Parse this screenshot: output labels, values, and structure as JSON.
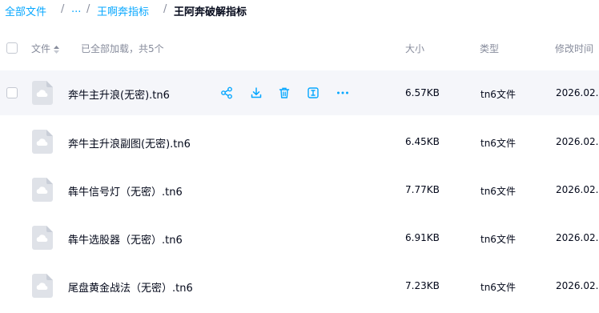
{
  "breadcrumb": {
    "items": [
      "全部文件",
      "...",
      "王啊奔指标"
    ],
    "current": "王阿奔破解指标",
    "separator": "/"
  },
  "list_header": {
    "name_label": "文件",
    "status_text": "已全部加载，共5个",
    "size_label": "大小",
    "type_label": "类型",
    "date_label": "修改时间"
  },
  "files": [
    {
      "name": "奔牛主升浪(无密).tn6",
      "size": "6.57KB",
      "type": "tn6文件",
      "date": "2026.02..."
    },
    {
      "name": "奔牛主升浪副图(无密).tn6",
      "size": "6.45KB",
      "type": "tn6文件",
      "date": "2026.02..."
    },
    {
      "name": "犇牛信号灯（无密）.tn6",
      "size": "7.77KB",
      "type": "tn6文件",
      "date": "2026.02..."
    },
    {
      "name": "犇牛选股器（无密）.tn6",
      "size": "6.91KB",
      "type": "tn6文件",
      "date": "2026.02..."
    },
    {
      "name": "尾盘黄金战法（无密）.tn6",
      "size": "7.23KB",
      "type": "tn6文件",
      "date": "2026.02..."
    }
  ],
  "row_actions": [
    "share-icon",
    "download-icon",
    "delete-icon",
    "rename-icon",
    "more-icon"
  ],
  "colors": {
    "accent": "#06a7ff",
    "text": "#03081a",
    "muted": "#878c9c",
    "hover_row": "#f5f6fa",
    "icon_bg": "#dfe2e8"
  }
}
